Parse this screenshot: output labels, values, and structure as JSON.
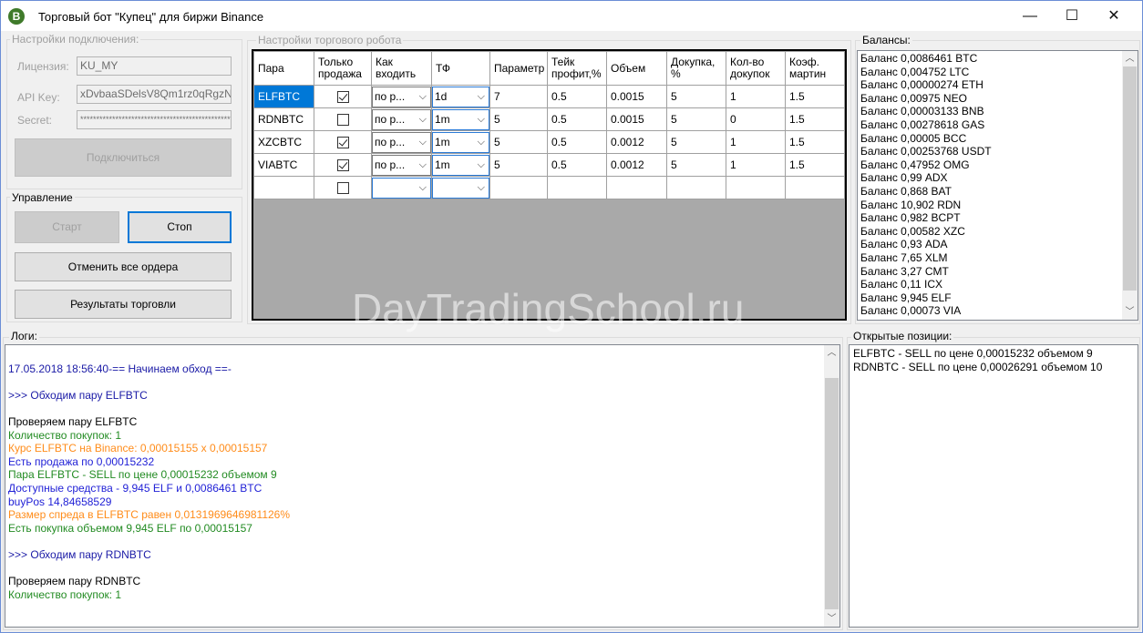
{
  "window": {
    "title": "Торговый бот \"Купец\" для биржи Binance",
    "icon_letter": "B",
    "minimize": "—",
    "maximize": "☐",
    "close": "✕"
  },
  "connection": {
    "group_label": "Настройки подключения:",
    "license_label": "Лицензия:",
    "license_value": "KU_MY",
    "apikey_label": "API Key:",
    "apikey_value": "xDvbaaSDelsV8Qm1rz0qRgzN",
    "secret_label": "Secret:",
    "secret_value": "************************************************",
    "connect_button": "Подключиться"
  },
  "control": {
    "group_label": "Управление",
    "start_button": "Старт",
    "stop_button": "Стоп",
    "cancel_orders_button": "Отменить все ордера",
    "results_button": "Результаты торговли"
  },
  "robot": {
    "group_label": "Настройки торгового робота",
    "columns": [
      "Пара",
      "Только продажа",
      "Как входить",
      "ТФ",
      "Параметр",
      "Тейк профит,%",
      "Объем",
      "Докупка, %",
      "Кол-во докупок",
      "Коэф. мартин"
    ],
    "rows": [
      {
        "pair": "ELFBTC",
        "sell_only": true,
        "entry": "по р...",
        "tf": "1d",
        "param": "7",
        "take": "0.5",
        "volume": "0.0015",
        "rebuy": "5",
        "rebuy_count": "1",
        "martin": "1.5"
      },
      {
        "pair": "RDNBTC",
        "sell_only": false,
        "entry": "по р...",
        "tf": "1m",
        "param": "5",
        "take": "0.5",
        "volume": "0.0015",
        "rebuy": "5",
        "rebuy_count": "0",
        "martin": "1.5"
      },
      {
        "pair": "XZCBTC",
        "sell_only": true,
        "entry": "по р...",
        "tf": "1m",
        "param": "5",
        "take": "0.5",
        "volume": "0.0012",
        "rebuy": "5",
        "rebuy_count": "1",
        "martin": "1.5"
      },
      {
        "pair": "VIABTC",
        "sell_only": true,
        "entry": "по р...",
        "tf": "1m",
        "param": "5",
        "take": "0.5",
        "volume": "0.0012",
        "rebuy": "5",
        "rebuy_count": "1",
        "martin": "1.5"
      },
      {
        "pair": "",
        "sell_only": false,
        "entry": "",
        "tf": "",
        "param": "",
        "take": "",
        "volume": "",
        "rebuy": "",
        "rebuy_count": "",
        "martin": ""
      }
    ]
  },
  "balances": {
    "group_label": "Балансы:",
    "items": [
      "Баланс 0,0086461 BTC",
      "Баланс 0,004752 LTC",
      "Баланс 0,00000274 ETH",
      "Баланс 0,00975 NEO",
      "Баланс 0,00003133 BNB",
      "Баланс 0,00278618 GAS",
      "Баланс 0,00005 BCC",
      "Баланс 0,00253768 USDT",
      "Баланс 0,47952 OMG",
      "Баланс 0,99 ADX",
      "Баланс 0,868 BAT",
      "Баланс 10,902 RDN",
      "Баланс 0,982 BCPT",
      "Баланс 0,00582 XZC",
      "Баланс 0,93 ADA",
      "Баланс 7,65 XLM",
      "Баланс 3,27 CMT",
      "Баланс 0,11 ICX",
      "Баланс 9,945 ELF",
      "Баланс 0,00073 VIA"
    ]
  },
  "logs": {
    "group_label": "Логи:",
    "lines": [
      {
        "text": "",
        "color": "#000000"
      },
      {
        "text": "17.05.2018 18:56:40-== Начинаем обход ==-",
        "color": "#1a1aa6"
      },
      {
        "text": "",
        "color": "#000000"
      },
      {
        "text": ">>> Обходим пару ELFBTC",
        "color": "#1a1aa6"
      },
      {
        "text": "",
        "color": "#000000"
      },
      {
        "text": "Проверяем пару ELFBTC",
        "color": "#000000"
      },
      {
        "text": "Количество покупок: 1",
        "color": "#228b22"
      },
      {
        "text": "Курс ELFBTC на Binance: 0,00015155 x 0,00015157",
        "color": "#ff8c1a"
      },
      {
        "text": "Есть продажа по 0,00015232",
        "color": "#1f1fd6"
      },
      {
        "text": " Пара ELFBTC - SELL по цене 0,00015232 объемом 9",
        "color": "#228b22"
      },
      {
        "text": "Доступные средства - 9,945 ELF и 0,0086461 BTC",
        "color": "#1f1fd6"
      },
      {
        "text": "buyPos 14,84658529",
        "color": "#1f1fd6"
      },
      {
        "text": "Размер спреда в ELFBTC равен 0,0131969646981126%",
        "color": "#ff8c1a"
      },
      {
        "text": "Есть покупка объемом 9,945 ELF по 0,00015157",
        "color": "#228b22"
      },
      {
        "text": "",
        "color": "#000000"
      },
      {
        "text": ">>> Обходим пару RDNBTC",
        "color": "#1a1aa6"
      },
      {
        "text": "",
        "color": "#000000"
      },
      {
        "text": "Проверяем пару RDNBTC",
        "color": "#000000"
      },
      {
        "text": "Количество покупок: 1",
        "color": "#228b22"
      }
    ]
  },
  "positions": {
    "group_label": "Открытые позиции:",
    "items": [
      "ELFBTC - SELL по цене 0,00015232 объемом 9",
      "RDNBTC - SELL по цене 0,00026291 объемом 10"
    ]
  },
  "watermark": "DayTradingSchool.ru"
}
